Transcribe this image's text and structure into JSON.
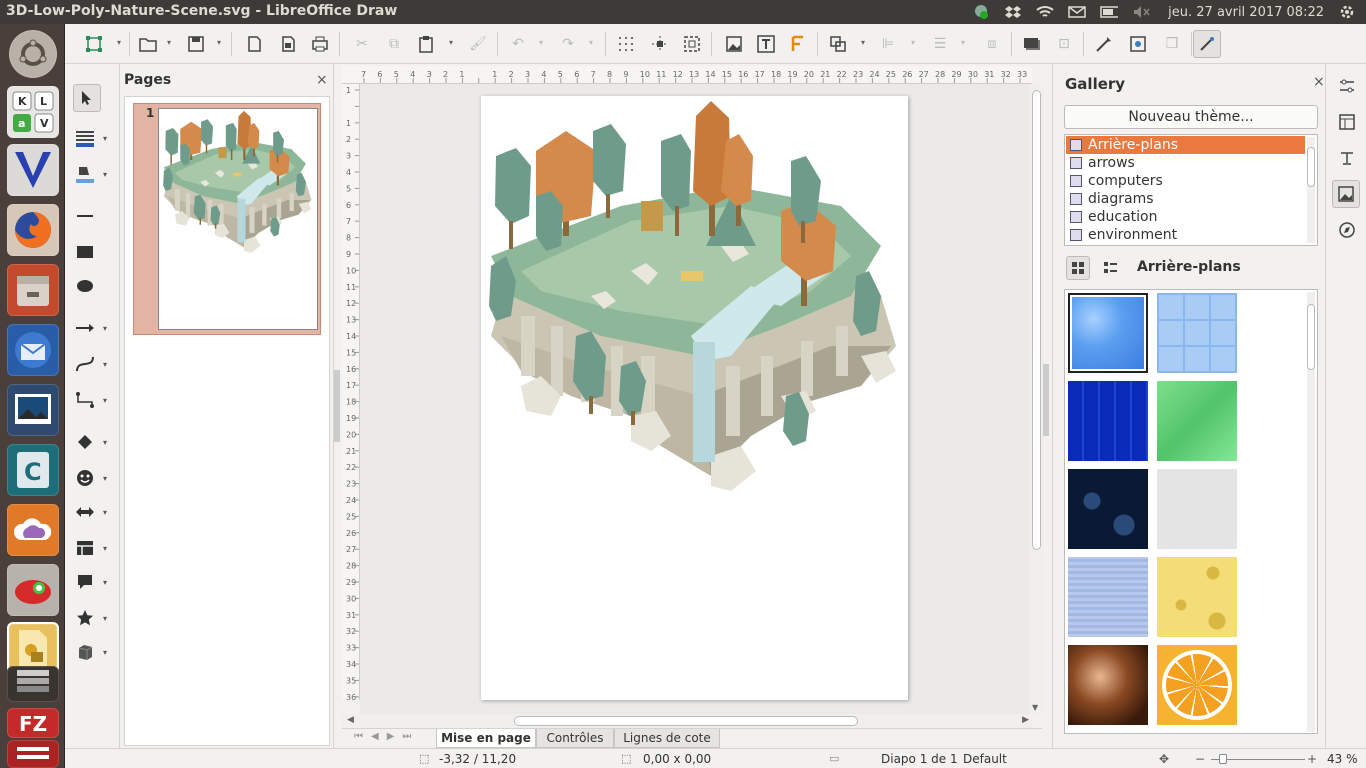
{
  "window": {
    "title": "3D-Low-Poly-Nature-Scene.svg - LibreOffice Draw"
  },
  "tray": {
    "clock": "jeu. 27 avril 2017 08:22"
  },
  "launcher": {
    "items": [
      "ubuntu-dash",
      "libreoffice-draw-k-l-a-v",
      "vim",
      "firefox",
      "files",
      "thunderbird",
      "image-viewer",
      "calibre-c",
      "cloud-app",
      "red-app",
      "libreoffice-impress",
      "stack-app",
      "filezilla",
      "more-app"
    ]
  },
  "pages_panel": {
    "title": "Pages",
    "close": "×",
    "thumb_number": "1"
  },
  "canvas": {
    "tabs": [
      "Mise en page",
      "Contrôles",
      "Lignes de cote"
    ],
    "active_tab": "Mise en page"
  },
  "gallery": {
    "title": "Gallery",
    "close": "×",
    "new_theme_button": "Nouveau thème...",
    "themes": [
      "Arrière-plans",
      "arrows",
      "computers",
      "diagrams",
      "education",
      "environment"
    ],
    "selected_theme": "Arrière-plans",
    "current_theme_label": "Arrière-plans",
    "textures": [
      "blue-water",
      "blue-tiles",
      "dark-blue-mosaic",
      "green-grass",
      "dark-bubbles",
      "white-paper",
      "blue-fabric",
      "cheese",
      "brown-swirl",
      "orange-slice"
    ]
  },
  "status": {
    "position": "-3,32 / 11,20",
    "size": "0,00 x 0,00",
    "slide": "Diapo 1 de 1",
    "layout": "Default",
    "zoom": "43 %"
  },
  "ruler": {
    "h_ticks": [
      "7",
      "6",
      "5",
      "4",
      "3",
      "2",
      "1",
      "",
      "1",
      "2",
      "3",
      "4",
      "5",
      "6",
      "7",
      "8",
      "9",
      "10",
      "11",
      "12",
      "13",
      "14",
      "15",
      "16",
      "17",
      "18",
      "19",
      "20",
      "21",
      "22",
      "23",
      "24",
      "25",
      "26",
      "27",
      "28",
      "29",
      "30",
      "31",
      "32",
      "33"
    ],
    "v_ticks": [
      "1",
      "",
      "1",
      "2",
      "3",
      "4",
      "5",
      "6",
      "7",
      "8",
      "9",
      "10",
      "11",
      "12",
      "13",
      "14",
      "15",
      "16",
      "17",
      "18",
      "19",
      "20",
      "21",
      "22",
      "23",
      "24",
      "25",
      "26",
      "27",
      "28",
      "29",
      "30",
      "31",
      "32",
      "33",
      "34",
      "35",
      "36"
    ]
  },
  "colors": {
    "accent": "#e9793f",
    "topbar": "#3c3b37",
    "launcher": "#4a3f3a"
  }
}
